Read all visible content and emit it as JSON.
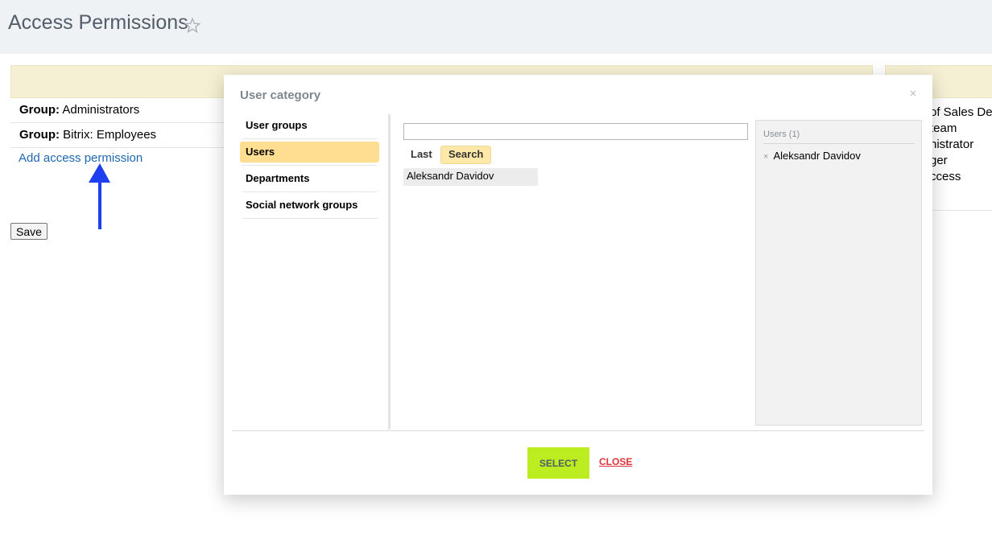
{
  "page": {
    "title": "Access Permissions",
    "favorite_icon": "star-icon"
  },
  "permissions": {
    "rows": [
      {
        "prefix": "Group:",
        "name": "Administrators"
      },
      {
        "prefix": "Group:",
        "name": "Bitrix: Employees"
      }
    ],
    "add_link": "Add access permission",
    "save_label": "Save"
  },
  "right_panel": {
    "items": [
      "of Sales Dep",
      "team",
      "nistrator",
      "ger",
      "ccess"
    ]
  },
  "dialog": {
    "title": "User category",
    "close_symbol": "×",
    "tabs": [
      "User groups",
      "Users",
      "Departments",
      "Social network groups"
    ],
    "active_tab": "Users",
    "search": {
      "value": "",
      "placeholder": ""
    },
    "subtabs": {
      "last": "Last",
      "search": "Search"
    },
    "results": [
      "Aleksandr Davidov"
    ],
    "selected": {
      "header": "Users (1)",
      "items": [
        "Aleksandr Davidov"
      ],
      "remove_symbol": "×"
    },
    "select_label": "SELECT",
    "close_label": "CLOSE"
  },
  "colors": {
    "header_bg": "#eef2f4",
    "table_head_bg": "#f5f0d3",
    "active_tab_bg": "#ffde92",
    "select_button": "#bbed21",
    "close_link": "#e0313a",
    "link": "#2067b0",
    "arrow": "#1e3ff0"
  }
}
